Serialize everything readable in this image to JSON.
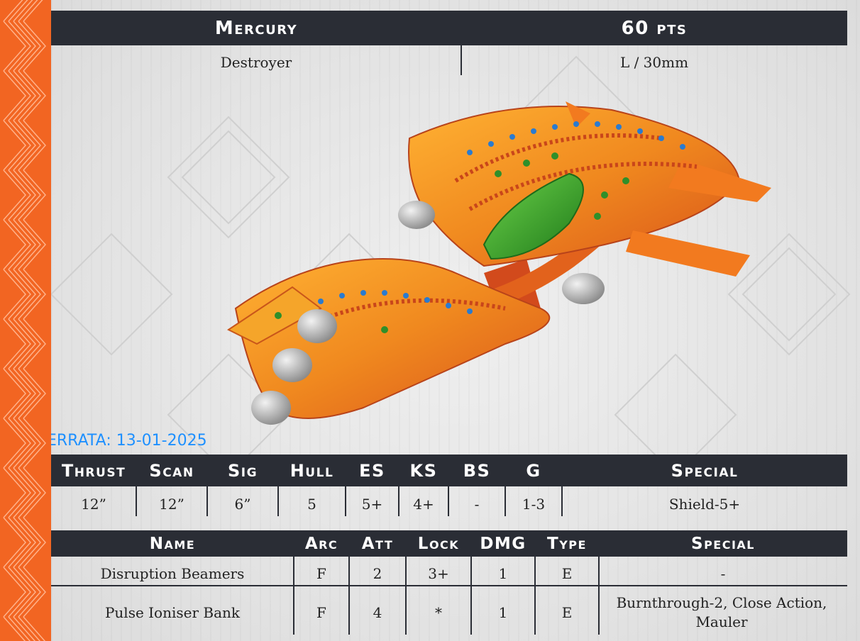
{
  "ship": {
    "name": "Mercury",
    "points": "60 pts",
    "class": "Destroyer",
    "tonnage": "L / 30mm",
    "image_alt": "orange-ship-miniature"
  },
  "errata": "ERRATA: 13-01-2025",
  "stats": {
    "headers": [
      "Thrust",
      "Scan",
      "Sig",
      "Hull",
      "ES",
      "KS",
      "BS",
      "G",
      "Special"
    ],
    "values": [
      "12”",
      "12”",
      "6”",
      "5",
      "5+",
      "4+",
      "-",
      "1-3",
      "Shield-5+"
    ]
  },
  "weapons": {
    "headers": [
      "Name",
      "Arc",
      "Att",
      "Lock",
      "DMG",
      "Type",
      "Special"
    ],
    "rows": [
      [
        "Disruption Beamers",
        "F",
        "2",
        "3+",
        "1",
        "E",
        "-"
      ],
      [
        "Pulse Ioniser Bank",
        "F",
        "4",
        "*",
        "1",
        "E",
        "Burnthrough-2, Close Action, Mauler"
      ]
    ]
  },
  "colors": {
    "stripe": "#f26522",
    "header_bg": "#2a2d35",
    "errata": "#1e90ff",
    "ship_orange": "#f0891f",
    "ship_green": "#3a9a2a"
  }
}
